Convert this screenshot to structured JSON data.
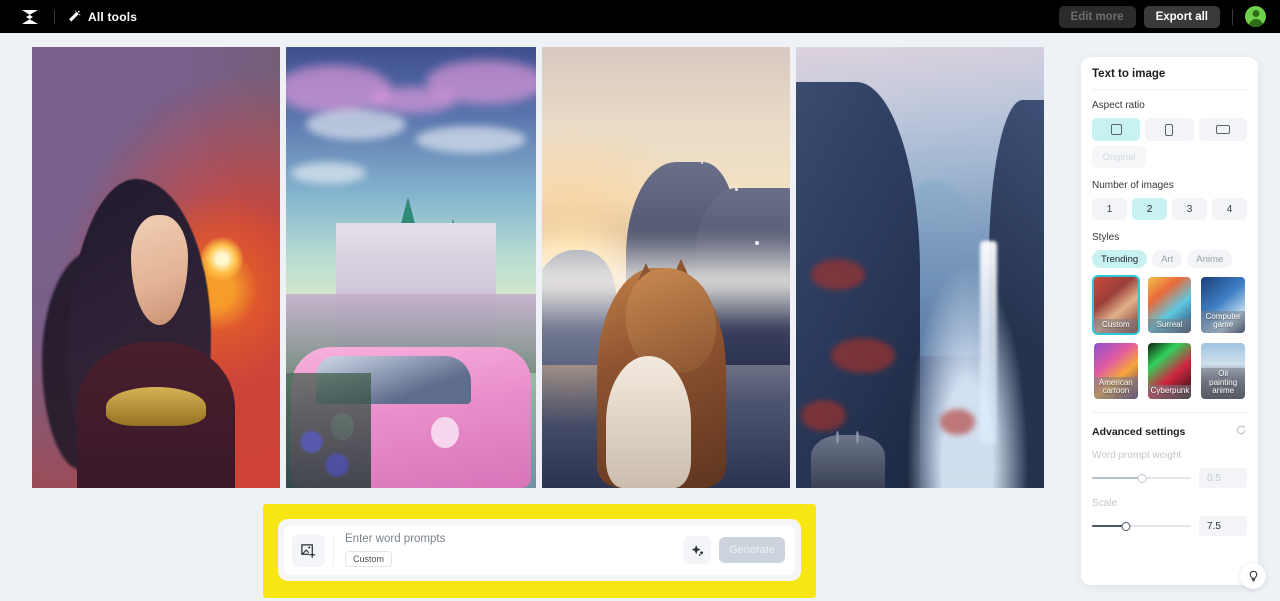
{
  "topbar": {
    "logo_icon": "capcut-logo-icon",
    "all_tools_icon": "magic-wand-icon",
    "all_tools_label": "All tools",
    "edit_more_label": "Edit more",
    "export_all_label": "Export all",
    "avatar_icon": "user-avatar"
  },
  "gallery": {
    "images": [
      {
        "alt": "fantasy warrior woman with dark hair and glowing fire orb"
      },
      {
        "alt": "pastel anime castle with pink vintage car"
      },
      {
        "alt": "tabby cat looking at sunlit mountains"
      },
      {
        "alt": "misty blue mountain valley with waterfall"
      }
    ]
  },
  "panel": {
    "title": "Text to image",
    "aspect_ratio": {
      "label": "Aspect ratio",
      "options": [
        {
          "name": "square",
          "icon": "square-icon",
          "selected": true
        },
        {
          "name": "portrait",
          "icon": "portrait-icon",
          "selected": false
        },
        {
          "name": "landscape",
          "icon": "landscape-icon",
          "selected": false
        }
      ],
      "original_label": "Original",
      "original_disabled": true
    },
    "number_of_images": {
      "label": "Number of images",
      "options": [
        "1",
        "2",
        "3",
        "4"
      ],
      "selected": "2"
    },
    "styles": {
      "label": "Styles",
      "tabs": [
        {
          "label": "Trending",
          "selected": true
        },
        {
          "label": "Art",
          "selected": false
        },
        {
          "label": "Anime",
          "selected": false
        }
      ],
      "cards": [
        {
          "label": "Custom",
          "selected": true
        },
        {
          "label": "Surreal",
          "selected": false
        },
        {
          "label": "Computer game",
          "selected": false
        },
        {
          "label": "American cartoon",
          "selected": false
        },
        {
          "label": "Cyberpunk",
          "selected": false
        },
        {
          "label": "Oil painting anime",
          "selected": false
        }
      ]
    },
    "advanced": {
      "title": "Advanced settings",
      "reset_icon": "reset-icon",
      "word_prompt_weight": {
        "label": "Word prompt weight",
        "value": "0.5",
        "slider_percent": 50,
        "disabled": true
      },
      "scale": {
        "label": "Scale",
        "value": "7.5",
        "slider_percent": 34,
        "disabled": false
      }
    }
  },
  "prompt_bar": {
    "image_add_icon": "image-add-icon",
    "placeholder": "Enter word prompts",
    "chip_label": "Custom",
    "sparkle_icon": "sparkle-icon",
    "generate_label": "Generate",
    "generate_disabled": true,
    "highlight_color": "#f5e614"
  },
  "help": {
    "icon": "lightbulb-icon"
  },
  "colors": {
    "accent": "#c8f2f2",
    "selection_border": "#2ec5d6",
    "topbar_bg": "#000000",
    "page_bg": "#eef1f5",
    "highlight": "#f5e614"
  }
}
